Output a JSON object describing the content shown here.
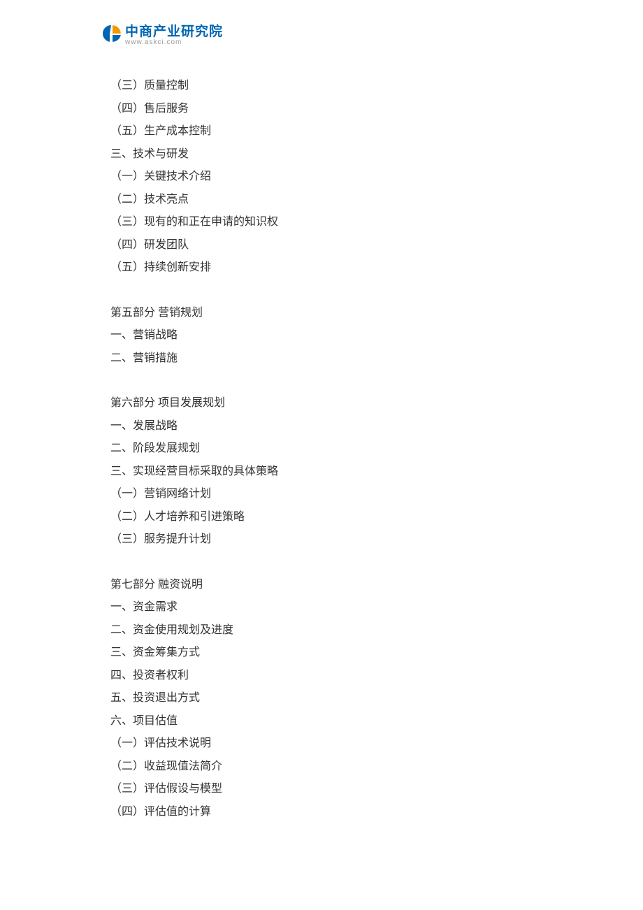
{
  "logo": {
    "name_cn": "中商产业研究院",
    "name_en": "www.askci.com"
  },
  "toc": {
    "lines": [
      "（三）质量控制",
      "（四）售后服务",
      "（五）生产成本控制",
      "三、技术与研发",
      "（一）关键技术介绍",
      "（二）技术亮点",
      "（三）现有的和正在申请的知识权",
      "（四）研发团队",
      "（五）持续创新安排"
    ],
    "part5_title": "第五部分  营销规划",
    "part5_lines": [
      "一、营销战略",
      "二、营销措施"
    ],
    "part6_title": "第六部分  项目发展规划",
    "part6_lines": [
      "一、发展战略",
      "二、阶段发展规划",
      "三、实现经营目标采取的具体策略",
      "（一）营销网络计划",
      "（二）人才培养和引进策略",
      "（三）服务提升计划"
    ],
    "part7_title": "第七部分  融资说明",
    "part7_lines": [
      "一、资金需求",
      "二、资金使用规划及进度",
      "三、资金筹集方式",
      "四、投资者权利",
      "五、投资退出方式",
      "六、项目估值",
      "（一）评估技术说明",
      "（二）收益现值法简介",
      "（三）评估假设与模型",
      "（四）评估值的计算"
    ]
  }
}
